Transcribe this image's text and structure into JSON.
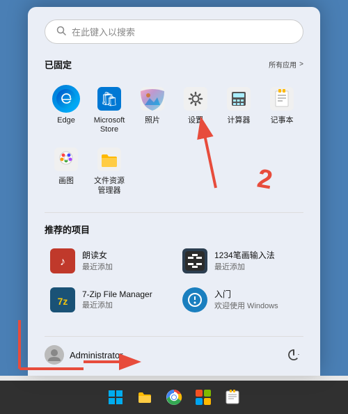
{
  "desktop": {
    "background": "#4a7fb5"
  },
  "search": {
    "placeholder": "在此键入以搜索"
  },
  "pinned": {
    "section_title": "已固定",
    "all_apps_label": "所有应用",
    "all_apps_arrow": ">",
    "apps": [
      {
        "id": "edge",
        "label": "Edge",
        "icon_type": "edge"
      },
      {
        "id": "store",
        "label": "Microsoft Store",
        "icon_type": "store"
      },
      {
        "id": "photos",
        "label": "照片",
        "icon_type": "photos"
      },
      {
        "id": "settings",
        "label": "设置",
        "icon_type": "settings"
      },
      {
        "id": "calculator",
        "label": "计算器",
        "icon_type": "calculator"
      },
      {
        "id": "notepad",
        "label": "记事本",
        "icon_type": "notepad"
      },
      {
        "id": "paint",
        "label": "画图",
        "icon_type": "paint"
      },
      {
        "id": "files",
        "label": "文件资源管理器",
        "icon_type": "files"
      }
    ]
  },
  "recommended": {
    "section_title": "推荐的项目",
    "items": [
      {
        "id": "reader",
        "name": "朗读女",
        "meta": "最近添加",
        "icon_type": "reader"
      },
      {
        "id": "ime",
        "name": "1234笔画输入法",
        "meta": "最近添加",
        "icon_type": "ime"
      },
      {
        "id": "7zip",
        "name": "7-Zip File Manager",
        "meta": "最近添加",
        "icon_type": "7zip"
      },
      {
        "id": "intro",
        "name": "入门",
        "meta": "欢迎使用 Windows",
        "icon_type": "intro"
      }
    ]
  },
  "user": {
    "name": "Administrator"
  },
  "taskbar": {
    "items": [
      {
        "id": "start",
        "icon_type": "windows"
      },
      {
        "id": "explorer",
        "icon_type": "folder"
      },
      {
        "id": "chrome",
        "icon_type": "chrome"
      },
      {
        "id": "store2",
        "icon_type": "store2"
      },
      {
        "id": "notepad2",
        "icon_type": "notepad2"
      }
    ]
  }
}
